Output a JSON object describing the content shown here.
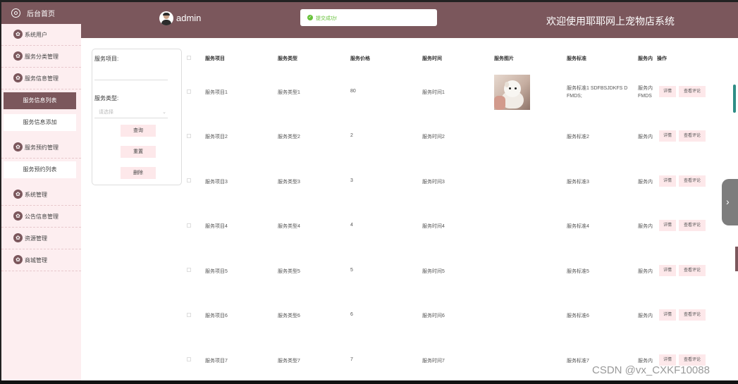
{
  "sidebar": {
    "home": "后台首页",
    "items": [
      {
        "label": "系统用户"
      },
      {
        "label": "服务分类管理"
      },
      {
        "label": "服务信息管理"
      },
      {
        "label": "服务信息列表"
      },
      {
        "label": "服务信息添加"
      },
      {
        "label": "服务预约管理"
      },
      {
        "label": "服务预约列表"
      },
      {
        "label": "系统管理"
      },
      {
        "label": "公告信息管理"
      },
      {
        "label": "资源管理"
      },
      {
        "label": "商城管理"
      }
    ]
  },
  "header": {
    "username": "admin",
    "toast": "提交成功!",
    "title": "欢迎使用耶耶网上宠物店系统"
  },
  "search": {
    "field1_label": "服务项目:",
    "field2_label": "服务类型:",
    "select_placeholder": "请选择",
    "query_button": "查询",
    "reset_button": "重置",
    "delete_button": "删除"
  },
  "table": {
    "columns": [
      "服务项目",
      "服务类型",
      "服务价格",
      "服务时间",
      "服务图片",
      "服务标准",
      "服务内",
      "操作"
    ],
    "rows": [
      {
        "item": "服务项目1",
        "type": "服务类型1",
        "price": "80",
        "time": "服务时间1",
        "standard": "服务标准1 SDFBSJDKFS D FMDS;",
        "content": "服务内 FMDS"
      },
      {
        "item": "服务项目2",
        "type": "服务类型2",
        "price": "2",
        "time": "服务时间2",
        "standard": "服务标准2",
        "content": "服务内"
      },
      {
        "item": "服务项目3",
        "type": "服务类型3",
        "price": "3",
        "time": "服务时间3",
        "standard": "服务标准3",
        "content": "服务内"
      },
      {
        "item": "服务项目4",
        "type": "服务类型4",
        "price": "4",
        "time": "服务时间4",
        "standard": "服务标准4",
        "content": "服务内"
      },
      {
        "item": "服务项目5",
        "type": "服务类型5",
        "price": "5",
        "time": "服务时间5",
        "standard": "服务标准5",
        "content": "服务内"
      },
      {
        "item": "服务项目6",
        "type": "服务类型6",
        "price": "6",
        "time": "服务时间6",
        "standard": "服务标准6",
        "content": "服务内"
      },
      {
        "item": "服务项目7",
        "type": "服务类型7",
        "price": "7",
        "time": "服务时间7",
        "standard": "服务标准7",
        "content": "服务内"
      }
    ],
    "detail_button": "详情",
    "review_button": "查看评论"
  },
  "watermark": "CSDN @vx_CXKF10088",
  "colors": {
    "primary": "#7b575c",
    "sidebar_bg": "#fdeef0",
    "button_bg": "#fde8ea",
    "success": "#67c23a"
  }
}
